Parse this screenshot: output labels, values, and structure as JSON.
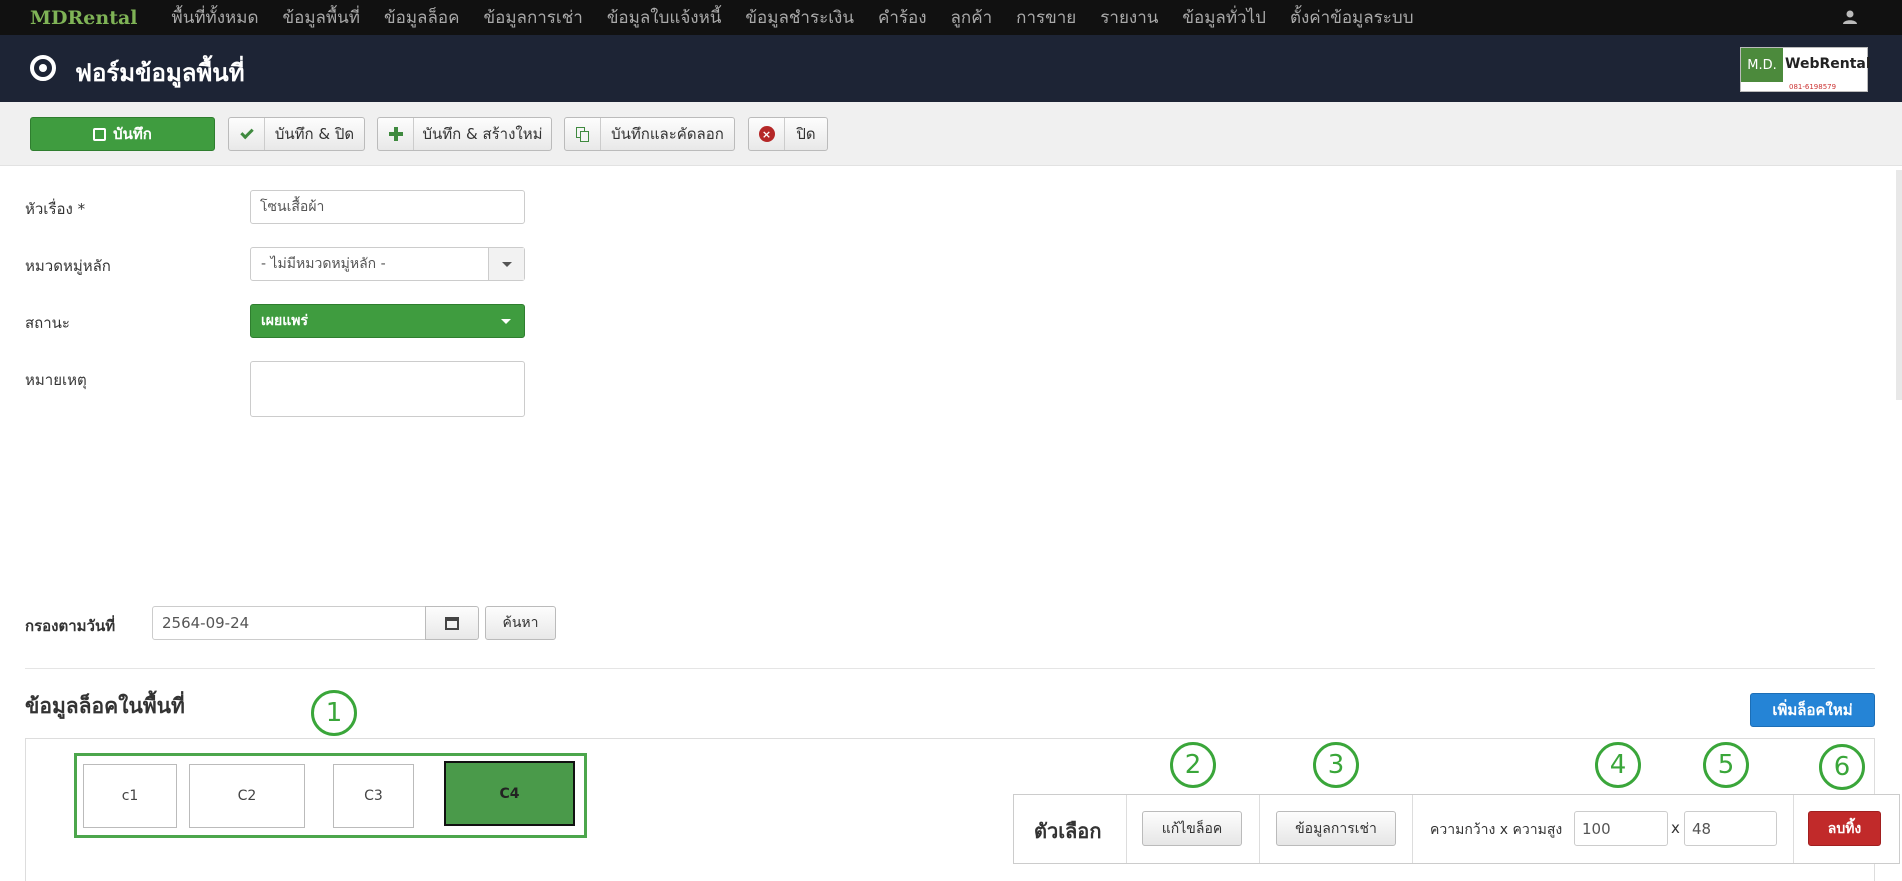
{
  "topnav": {
    "brand": "MDRental",
    "items": [
      "พื้นที่ทั้งหมด",
      "ข้อมูลพื้นที่",
      "ข้อมูลล็อค",
      "ข้อมูลการเช่า",
      "ข้อมูลใบแจ้งหนี้",
      "ข้อมูลชำระเงิน",
      "คำร้อง",
      "ลูกค้า",
      "การขาย",
      "รายงาน",
      "ข้อมูลทั่วไป",
      "ตั้งค่าข้อมูลระบบ"
    ]
  },
  "header": {
    "title": "ฟอร์มข้อมูลพื้นที่",
    "logo": {
      "md": "M.D.",
      "name": "WebRental",
      "phone": "081-6198579"
    }
  },
  "toolbar": {
    "save": "บันทึก",
    "save_close": "บันทึก & ปิด",
    "save_new": "บันทึก & สร้างใหม่",
    "save_copy": "บันทึกและคัดลอก",
    "close": "ปิด"
  },
  "form": {
    "title_label": "หัวเรื่อง *",
    "title_value": "โซนเสื้อผ้า",
    "category_label": "หมวดหมู่หลัก",
    "category_value": "- ไม่มีหมวดหมู่หลัก -",
    "status_label": "สถานะ",
    "status_value": "เผยแพร่",
    "note_label": "หมายเหตุ",
    "note_value": ""
  },
  "filter": {
    "label": "กรองตามวันที่",
    "date_value": "2564-09-24",
    "search": "ค้นหา"
  },
  "locks": {
    "section_title": "ข้อมูลล็อคในพื้นที่",
    "add_button": "เพิ่มล็อคใหม่",
    "blocks": [
      "c1",
      "C2",
      "C3",
      "C4"
    ],
    "active_block": "C4"
  },
  "options": {
    "title": "ตัวเลือก",
    "edit_lock": "แก้ไขล็อค",
    "rental_info": "ข้อมูลการเช่า",
    "size_label": "ความกว้าง x ความสูง",
    "width": "100",
    "times": "x",
    "height": "48",
    "delete": "ลบทิ้ง"
  },
  "callouts": [
    "1",
    "2",
    "3",
    "4",
    "5",
    "6"
  ],
  "colors": {
    "nav_bg": "#111111",
    "header_bg": "#1d2435",
    "green": "#3f9c3f",
    "blue": "#2584d6",
    "red": "#c12a2a",
    "brand": "#7fb356"
  }
}
